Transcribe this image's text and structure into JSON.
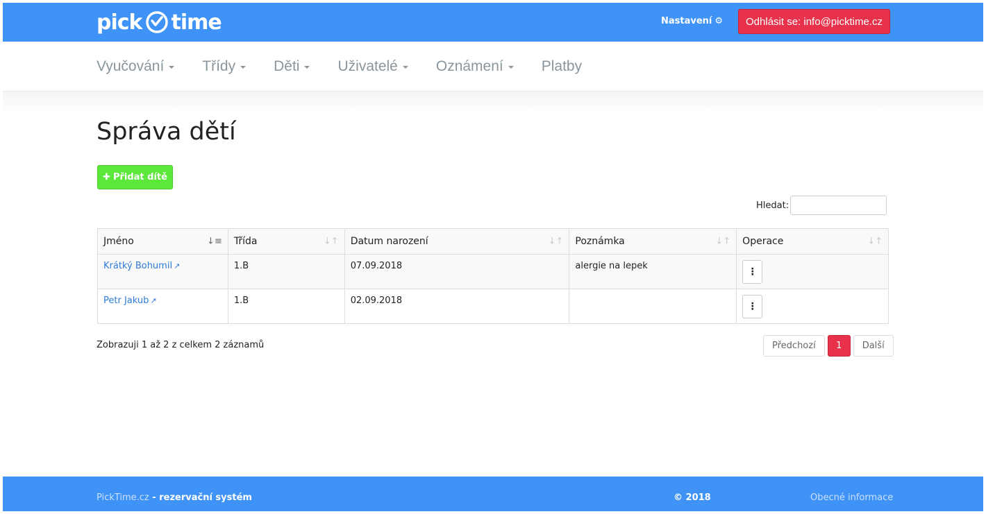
{
  "header": {
    "logo_left": "pick",
    "logo_right": "time",
    "settings_label": "Nastavení",
    "logout_label": "Odhlásit se: info@picktime.cz"
  },
  "nav": {
    "items": [
      {
        "label": "Vyučování",
        "dropdown": true
      },
      {
        "label": "Třídy",
        "dropdown": true
      },
      {
        "label": "Děti",
        "dropdown": true
      },
      {
        "label": "Uživatelé",
        "dropdown": true
      },
      {
        "label": "Oznámení",
        "dropdown": true
      },
      {
        "label": "Platby",
        "dropdown": false
      }
    ]
  },
  "page": {
    "title": "Správa dětí",
    "add_button": "Přidat dítě",
    "search_label": "Hledat:",
    "search_value": ""
  },
  "table": {
    "columns": [
      "Jméno",
      "Třída",
      "Datum narození",
      "Poznámka",
      "Operace"
    ],
    "rows": [
      {
        "name": "Krátký Bohumil",
        "class": "1.B",
        "birth": "07.09.2018",
        "note": "alergie na lepek"
      },
      {
        "name": "Petr Jakub",
        "class": "1.B",
        "birth": "02.09.2018",
        "note": ""
      }
    ]
  },
  "pagination": {
    "info": "Zobrazuji 1 až 2 z celkem 2 záznamů",
    "prev": "Předchozí",
    "current": "1",
    "next": "Další"
  },
  "footer": {
    "site": "PickTime.cz",
    "system": " - rezervační systém",
    "copyright": "© 2018",
    "info_link": "Obecné informace"
  },
  "colors": {
    "brand_blue": "#3f93f6",
    "danger_red": "#e8314b",
    "success_green": "#5be83a",
    "link_blue": "#2f7bd9"
  }
}
